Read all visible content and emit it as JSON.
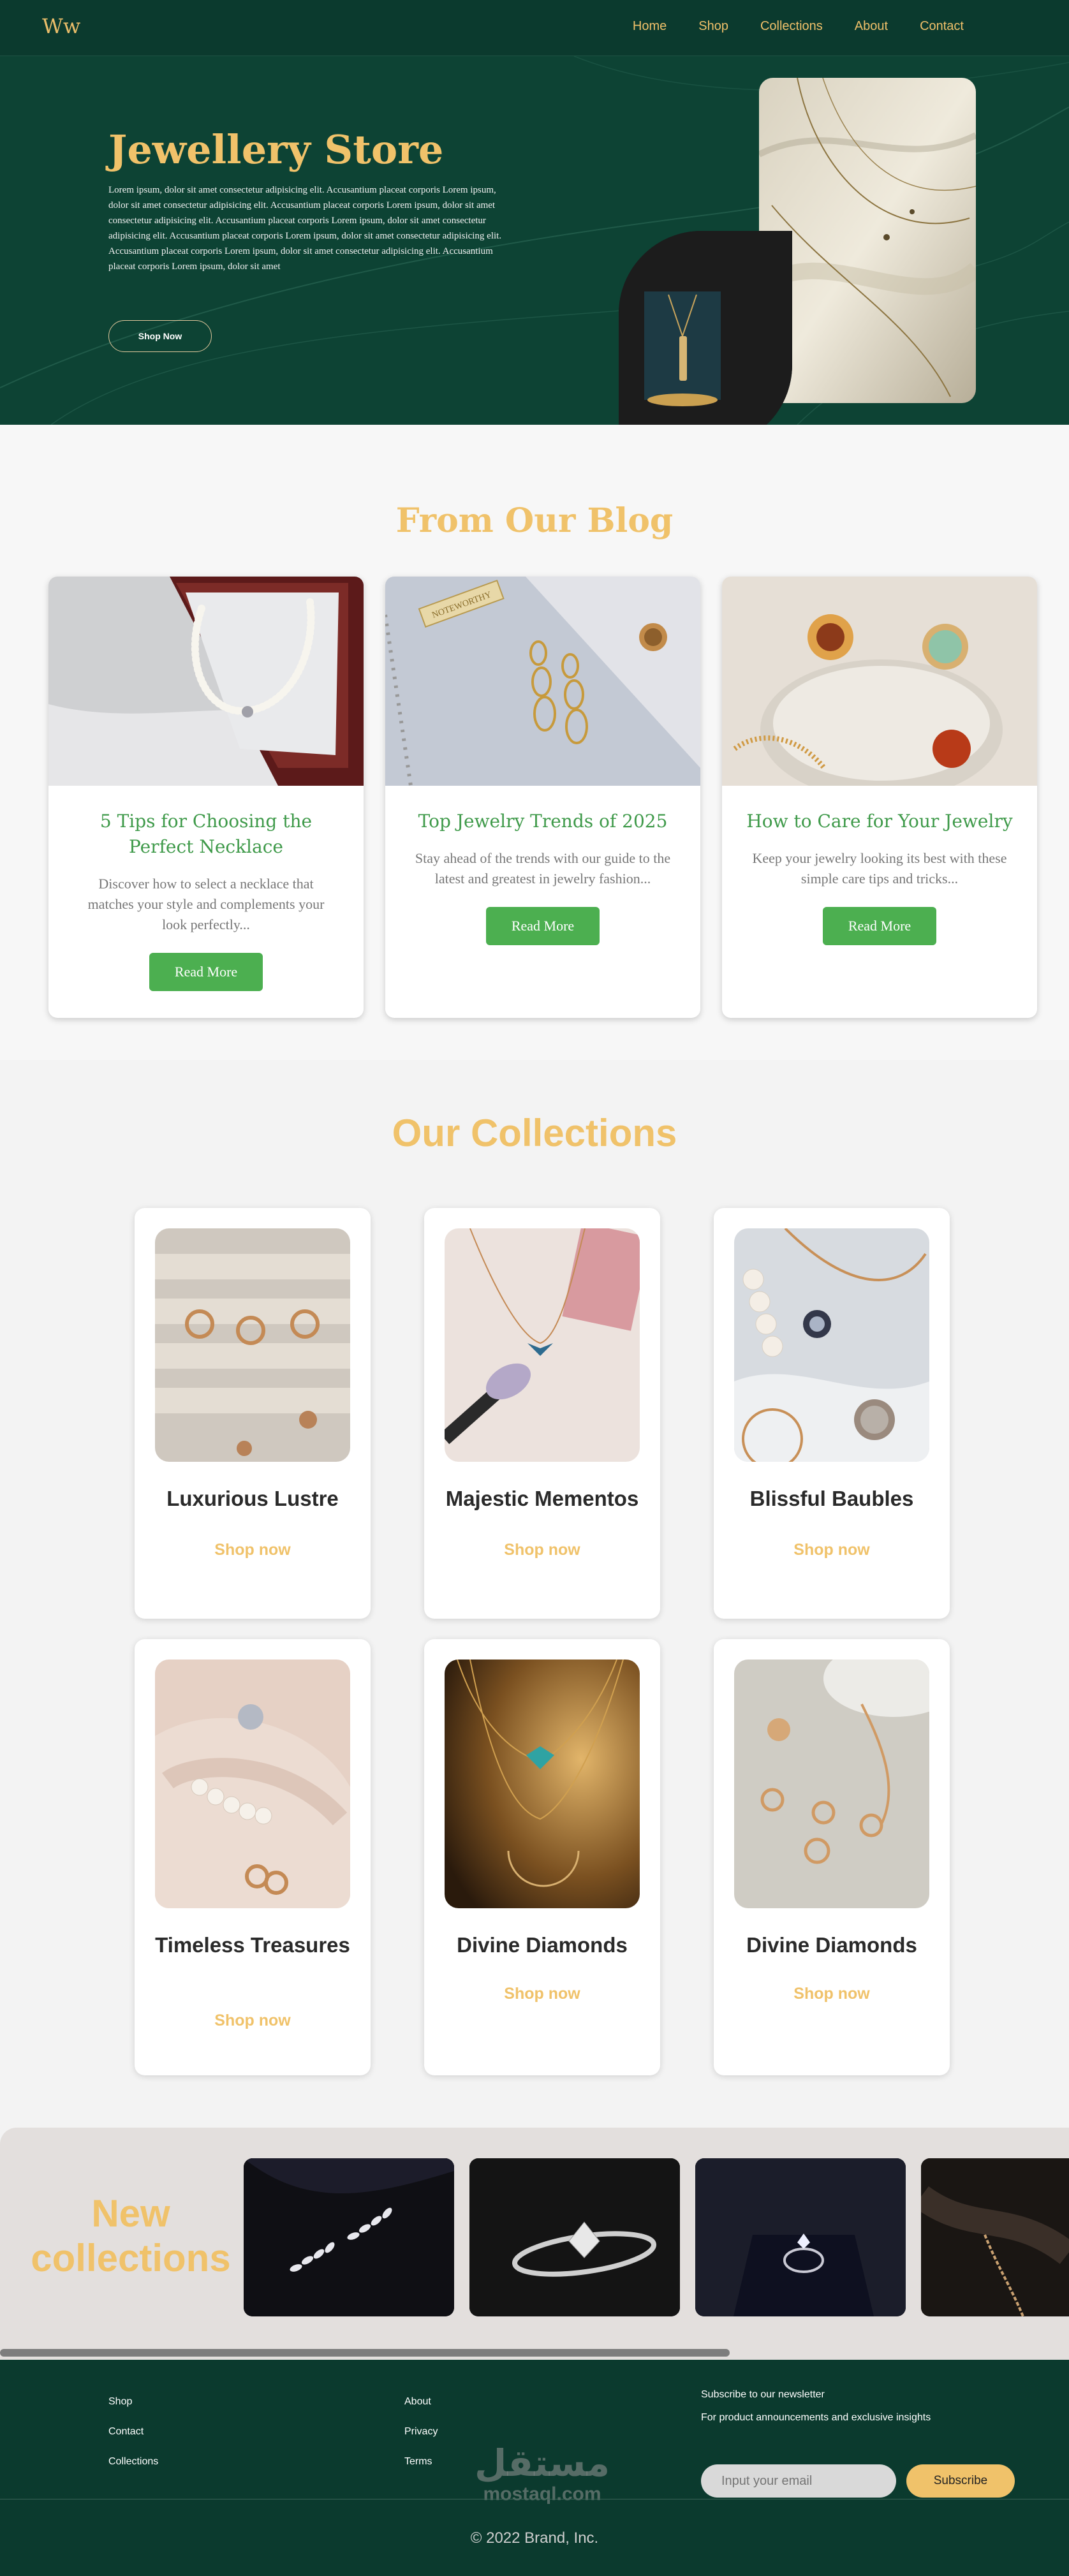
{
  "nav": {
    "logo": "Ww",
    "links": [
      "Home",
      "Shop",
      "Collections",
      "About",
      "Contact"
    ]
  },
  "hero": {
    "title": "Jewellery Store",
    "text": "Lorem ipsum, dolor sit amet consectetur adipisicing elit. Accusantium placeat corporis Lorem ipsum, dolor sit amet consectetur adipisicing elit. Accusantium placeat corporis Lorem ipsum, dolor sit amet consectetur adipisicing elit. Accusantium placeat corporis Lorem ipsum, dolor sit amet consectetur adipisicing elit. Accusantium placeat corporis Lorem ipsum, dolor sit amet consectetur adipisicing elit. Accusantium placeat corporis Lorem ipsum, dolor sit amet consectetur adipisicing elit. Accusantium placeat corporis Lorem ipsum, dolor sit amet",
    "button": "Shop Now"
  },
  "blog": {
    "title": "From Our Blog",
    "posts": [
      {
        "title": "5 Tips for Choosing the Perfect Necklace",
        "excerpt": "Discover how to select a necklace that matches your style and complements your look perfectly...",
        "button": "Read More"
      },
      {
        "title": "Top Jewelry Trends of 2025",
        "excerpt": "Stay ahead of the trends with our guide to the latest and greatest in jewelry fashion...",
        "button": "Read More"
      },
      {
        "title": "How to Care for Your Jewelry",
        "excerpt": "Keep your jewelry looking its best with these simple care tips and tricks...",
        "button": "Read More"
      }
    ],
    "stamp": "NOTEWORTHY"
  },
  "collections": {
    "title": "Our Collections",
    "items": [
      {
        "name": "Luxurious Lustre",
        "link": "Shop now"
      },
      {
        "name": "Majestic Mementos",
        "link": "Shop now"
      },
      {
        "name": "Blissful Baubles",
        "link": "Shop now"
      },
      {
        "name": "Timeless Treasures",
        "link": "Shop now"
      },
      {
        "name": "Divine Diamonds",
        "link": "Shop now"
      },
      {
        "name": "Divine Diamonds",
        "link": "Shop now"
      }
    ]
  },
  "new_collections": {
    "title": "New collections"
  },
  "footer": {
    "col1": [
      "Shop",
      "Contact",
      "Collections"
    ],
    "col2": [
      "About",
      "Privacy",
      "Terms"
    ],
    "newsletter_title": "Subscribe to our newsletter",
    "newsletter_sub": "For product announcements and exclusive insights",
    "input_placeholder": "Input your email",
    "subscribe": "Subscribe",
    "copyright": "© 2022 Brand, Inc.",
    "watermark_ar": "مستقل",
    "watermark_lt": "mostaql.com"
  },
  "colors": {
    "dark_green": "#0b3a2e",
    "hero_green": "#0d4334",
    "gold": "#f0c26a",
    "blog_green": "#3f9a4a",
    "button_green": "#4caf50"
  }
}
